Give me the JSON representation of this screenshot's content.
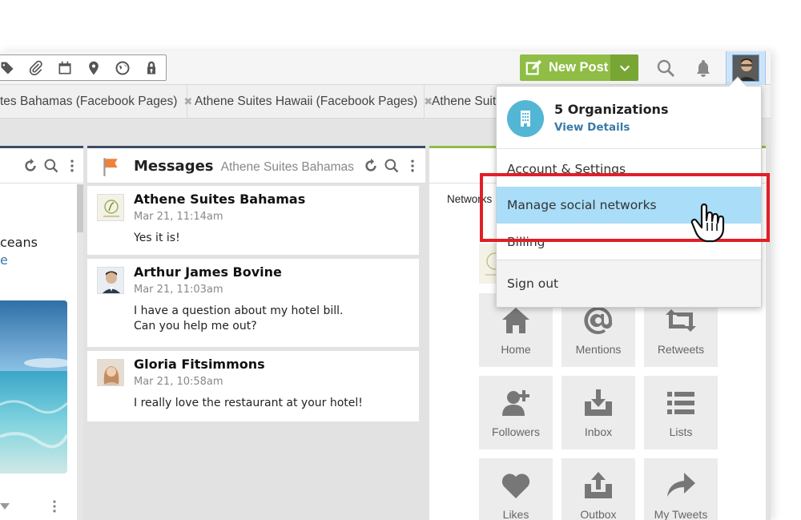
{
  "toolbar": {
    "tool_icons": [
      "tag-icon",
      "paperclip-icon",
      "calendar-icon",
      "location-pin-icon",
      "globe-icon",
      "lock-icon"
    ]
  },
  "header": {
    "new_post_label": "New Post",
    "brand_color": "#8fbd45"
  },
  "tabs": [
    {
      "label": "tes Bahamas (Facebook Pages)",
      "closable": true
    },
    {
      "label": "Athene Suites Hawaii (Facebook Pages)",
      "closable": true
    },
    {
      "label": "Athene Suite",
      "closable": false
    }
  ],
  "left_column": {
    "snippet_text": "ceans",
    "snippet_link": "e"
  },
  "messages_column": {
    "title": "Messages",
    "subtitle": "Athene Suites Bahamas",
    "items": [
      {
        "name": "Athene Suites Bahamas",
        "time": "Mar 21, 11:14am",
        "body": "Yes it is!"
      },
      {
        "name": "Arthur James Bovine",
        "time": "Mar 21, 11:03am",
        "body": "I have a question about my hotel bill.\nCan you help me out?"
      },
      {
        "name": "Gloria Fitsimmons",
        "time": "Mar 21, 10:58am",
        "body": "I really love the restaurant at your hotel!"
      }
    ]
  },
  "networks_column": {
    "partial_label": "Networks",
    "tiles": [
      {
        "label": "Home",
        "icon": "home-icon"
      },
      {
        "label": "Mentions",
        "icon": "at-icon"
      },
      {
        "label": "Retweets",
        "icon": "retweet-icon"
      },
      {
        "label": "Followers",
        "icon": "add-user-icon"
      },
      {
        "label": "Inbox",
        "icon": "inbox-icon"
      },
      {
        "label": "Lists",
        "icon": "list-icon"
      },
      {
        "label": "Likes",
        "icon": "heart-icon"
      },
      {
        "label": "Outbox",
        "icon": "outbox-icon"
      },
      {
        "label": "My Tweets",
        "icon": "share-arrow-icon"
      }
    ]
  },
  "account_menu": {
    "org_count_label": "5 Organizations",
    "view_details": "View Details",
    "items": [
      "Account & Settings",
      "Manage social networks",
      "Billing"
    ],
    "active_item": "Manage social networks",
    "sign_out": "Sign out",
    "highlight_color": "#e21f26",
    "active_color": "#a9ddf8"
  }
}
